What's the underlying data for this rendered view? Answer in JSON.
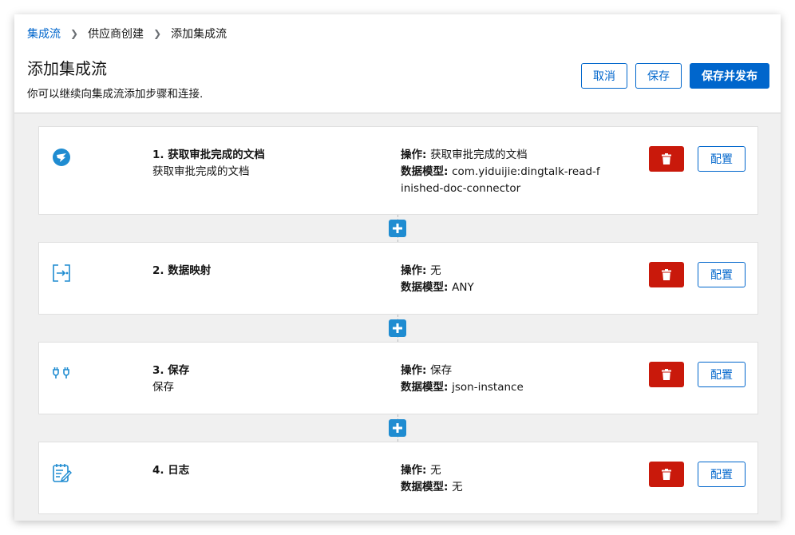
{
  "breadcrumb": {
    "root": "集成流",
    "parent": "供应商创建",
    "current": "添加集成流"
  },
  "page": {
    "title": "添加集成流",
    "description": "你可以继续向集成流添加步骤和连接."
  },
  "actions": {
    "cancel": "取消",
    "save": "保存",
    "save_publish": "保存并发布"
  },
  "labels": {
    "operation": "操作: ",
    "data_model": "数据模型: ",
    "delete_icon": "trash-icon",
    "configure": "配置"
  },
  "steps": [
    {
      "name": "1. 获取审批完成的文档",
      "subtitle": "获取审批完成的文档",
      "operation": "获取审批完成的文档",
      "data_model": "com.yiduijie:dingtalk-read-finished-doc-connector",
      "icon": "dingtalk-icon"
    },
    {
      "name": "2. 数据映射",
      "subtitle": "",
      "operation": "无",
      "data_model": "ANY",
      "icon": "data-mapper-icon"
    },
    {
      "name": "3. 保存",
      "subtitle": "保存",
      "operation": "保存",
      "data_model": "json-instance",
      "icon": "plug-icon"
    },
    {
      "name": "4. 日志",
      "subtitle": "",
      "operation": "无",
      "data_model": "无",
      "icon": "log-edit-icon"
    }
  ],
  "colors": {
    "primary": "#0066cc",
    "danger": "#c9190b",
    "add": "#1f8cd1",
    "background": "#f0f0f0"
  }
}
